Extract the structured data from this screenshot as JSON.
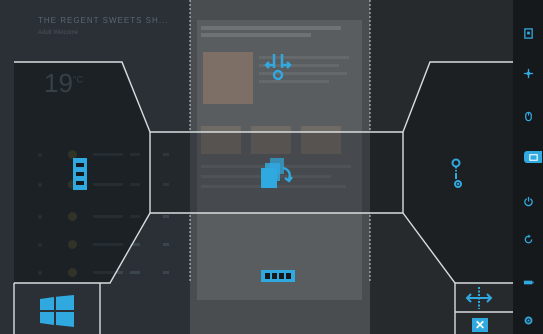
{
  "desktop": {
    "header": "THE REGENT SWEETS SH...",
    "subheader": "Adult Welcome",
    "weather": {
      "temperature": "19",
      "unit": "°C"
    }
  },
  "colors": {
    "accent": "#30a9e0",
    "overlay_line": "#d8dde0",
    "sidebar": "#16191c"
  },
  "layout_zones": [
    {
      "name": "zone-top-snap",
      "icon": "converge-icon"
    },
    {
      "name": "zone-left",
      "icon": "tile-stack-icon"
    },
    {
      "name": "zone-center",
      "icon": "cascade-windows-icon"
    },
    {
      "name": "zone-right",
      "icon": "key-gear-icon"
    },
    {
      "name": "zone-bottom",
      "icon": "tile-row-icon"
    },
    {
      "name": "start-zone",
      "icon": "windows-logo-icon"
    }
  ],
  "controls": {
    "move_icon": "move-arrows-icon",
    "close_label": "✕"
  },
  "sidebar": {
    "items": [
      {
        "icon": "app-icon"
      },
      {
        "icon": "compass-icon"
      },
      {
        "icon": "mouse-icon"
      },
      {
        "icon": "active-tab-icon",
        "active": true
      },
      {
        "icon": "power-icon"
      },
      {
        "icon": "refresh-icon"
      },
      {
        "icon": "battery-icon"
      },
      {
        "icon": "settings-icon"
      }
    ]
  }
}
